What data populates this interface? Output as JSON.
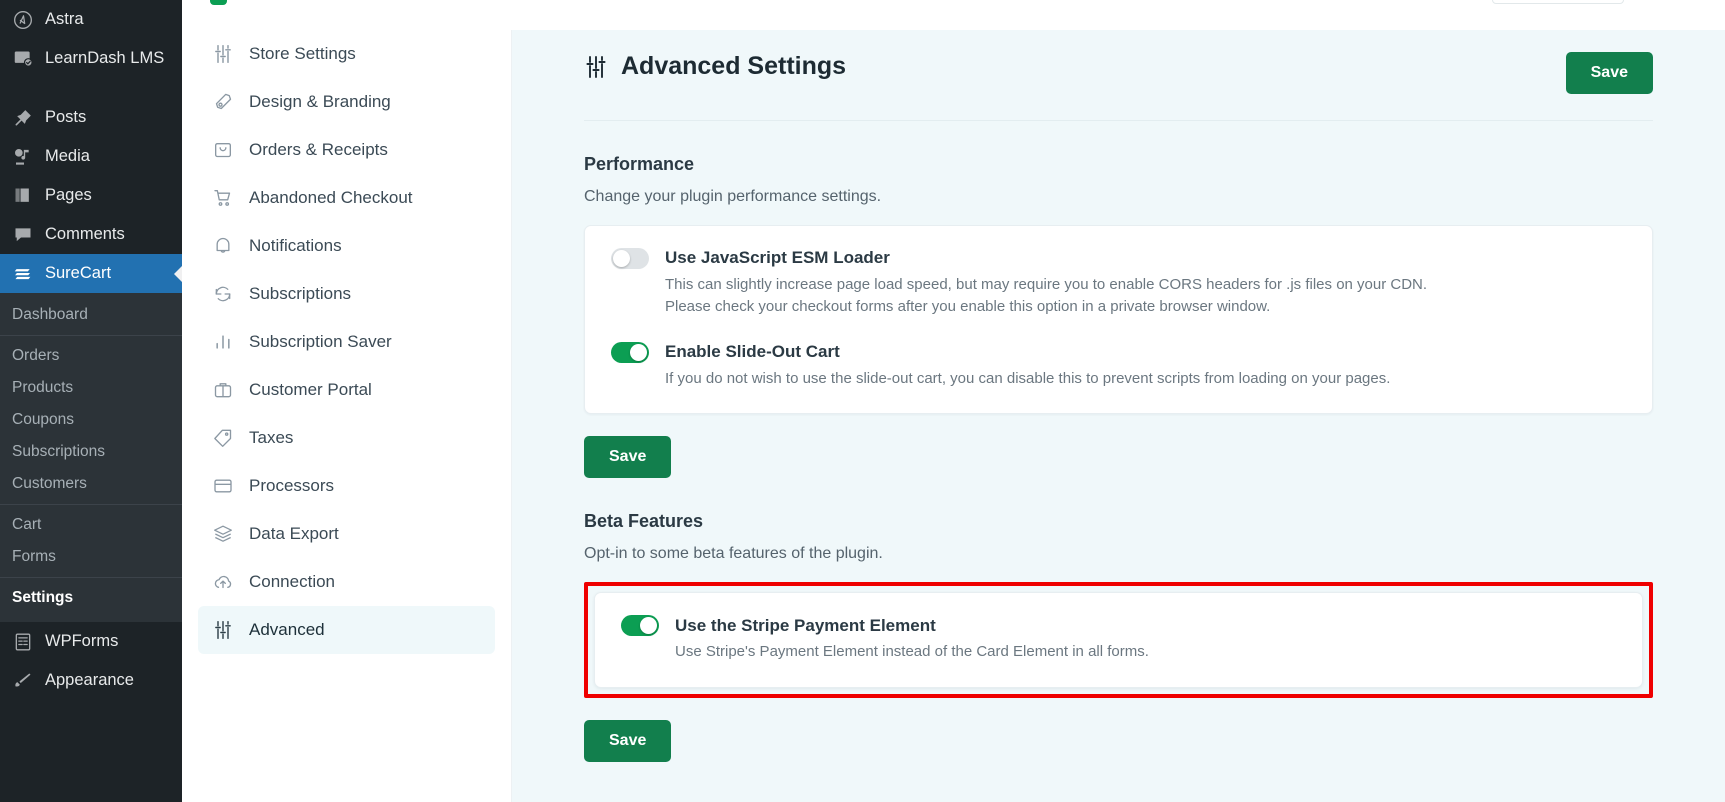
{
  "wp_sidebar": {
    "items": [
      {
        "label": "Astra",
        "icon": "astra-logo-icon"
      },
      {
        "label": "LearnDash LMS",
        "icon": "learndash-icon"
      },
      {
        "label": "Posts",
        "icon": "pin-icon"
      },
      {
        "label": "Media",
        "icon": "media-icon"
      },
      {
        "label": "Pages",
        "icon": "pages-icon"
      },
      {
        "label": "Comments",
        "icon": "comment-icon"
      },
      {
        "label": "SureCart",
        "icon": "surecart-icon",
        "current": true
      }
    ],
    "submenu_groups": [
      {
        "items": [
          {
            "label": "Dashboard"
          }
        ]
      },
      {
        "items": [
          {
            "label": "Orders"
          },
          {
            "label": "Products"
          },
          {
            "label": "Coupons"
          },
          {
            "label": "Subscriptions"
          },
          {
            "label": "Customers"
          }
        ]
      },
      {
        "items": [
          {
            "label": "Cart"
          },
          {
            "label": "Forms"
          }
        ]
      },
      {
        "items": [
          {
            "label": "Settings",
            "current": true
          }
        ]
      }
    ],
    "after_items": [
      {
        "label": "WPForms",
        "icon": "wpforms-icon"
      },
      {
        "label": "Appearance",
        "icon": "brush-icon"
      }
    ]
  },
  "settings_nav": {
    "items": [
      {
        "label": "Store Settings",
        "icon": "sliders-icon"
      },
      {
        "label": "Design & Branding",
        "icon": "pen-nib-icon"
      },
      {
        "label": "Orders & Receipts",
        "icon": "bag-icon"
      },
      {
        "label": "Abandoned Checkout",
        "icon": "cart-icon"
      },
      {
        "label": "Notifications",
        "icon": "bell-icon"
      },
      {
        "label": "Subscriptions",
        "icon": "refresh-icon"
      },
      {
        "label": "Subscription Saver",
        "icon": "bar-chart-icon"
      },
      {
        "label": "Customer Portal",
        "icon": "briefcase-icon"
      },
      {
        "label": "Taxes",
        "icon": "tag-icon"
      },
      {
        "label": "Processors",
        "icon": "credit-card-icon"
      },
      {
        "label": "Data Export",
        "icon": "layers-icon"
      },
      {
        "label": "Connection",
        "icon": "cloud-upload-icon"
      },
      {
        "label": "Advanced",
        "icon": "sliders-icon",
        "active": true
      }
    ]
  },
  "main": {
    "title": "Advanced Settings",
    "title_icon": "sliders-icon",
    "save_label": "Save",
    "performance": {
      "heading": "Performance",
      "subheading": "Change your plugin performance settings.",
      "options": [
        {
          "label": "Use JavaScript ESM Loader",
          "description": "This can slightly increase page load speed, but may require you to enable CORS headers for .js files on your CDN. Please check your checkout forms after you enable this option in a private browser window.",
          "enabled": false
        },
        {
          "label": "Enable Slide-Out Cart",
          "description": "If you do not wish to use the slide-out cart, you can disable this to prevent scripts from loading on your pages.",
          "enabled": true
        }
      ],
      "save_label": "Save"
    },
    "beta": {
      "heading": "Beta Features",
      "subheading": "Opt-in to some beta features of the plugin.",
      "highlighted": true,
      "options": [
        {
          "label": "Use the Stripe Payment Element",
          "description": "Use Stripe's Payment Element instead of the Card Element in all forms.",
          "enabled": true
        }
      ],
      "save_label": "Save"
    }
  },
  "colors": {
    "accent_green": "#127f4d",
    "toggle_on": "#0c9e53",
    "wp_current": "#2271b1",
    "highlight_red": "#ef0000",
    "panel_bg": "#f0f8fa"
  }
}
